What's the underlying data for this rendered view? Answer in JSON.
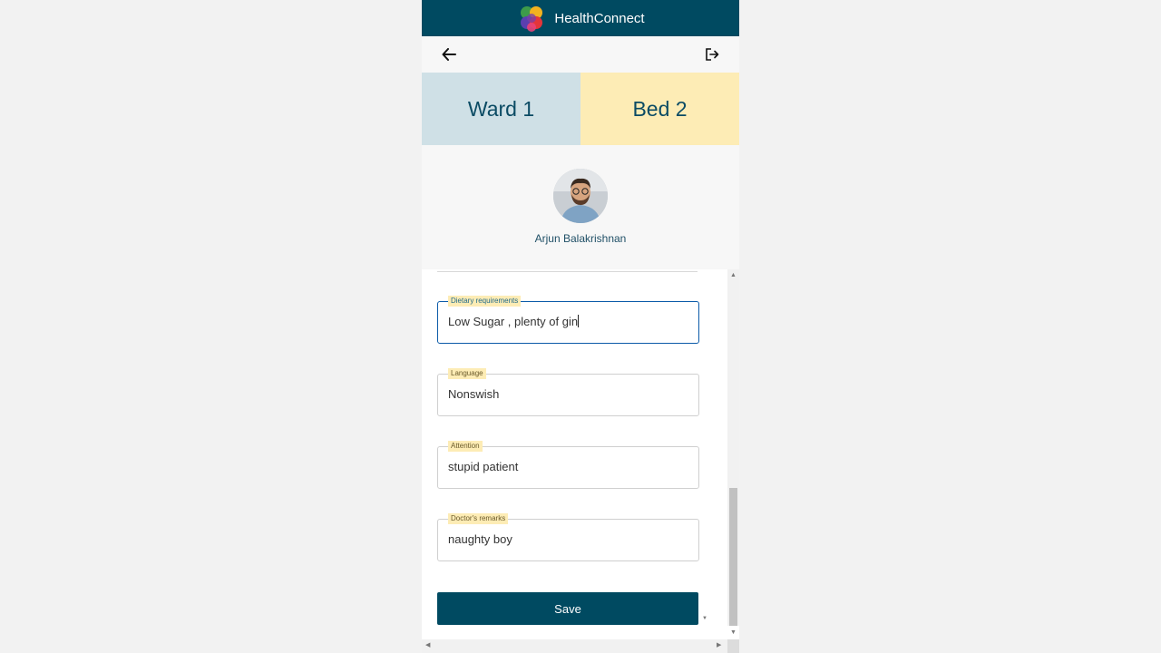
{
  "app": {
    "brand": "HealthConnect",
    "logo": "clover-logo"
  },
  "nav": {
    "back_icon": "back-arrow-icon",
    "logout_icon": "logout-icon"
  },
  "tiles": {
    "ward": "Ward 1",
    "bed": "Bed 2"
  },
  "patient": {
    "name": "Arjun Balakrishnan"
  },
  "form": {
    "fields": [
      {
        "label": "Dietary requirements",
        "value": "Low Sugar , plenty of gin"
      },
      {
        "label": "Language",
        "value": "Nonswish"
      },
      {
        "label": "Attention",
        "value": "stupid patient"
      },
      {
        "label": "Doctor's remarks",
        "value": "naughty boy"
      }
    ],
    "save_label": "Save"
  },
  "colors": {
    "header": "#004a61",
    "ward_tile": "#cfe0e6",
    "bed_tile": "#fdecb5",
    "focus": "#0b5aa8"
  }
}
